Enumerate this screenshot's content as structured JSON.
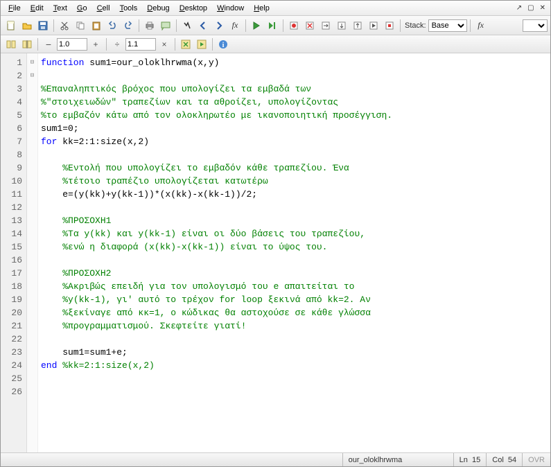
{
  "menu": [
    "File",
    "Edit",
    "Text",
    "Go",
    "Cell",
    "Tools",
    "Debug",
    "Desktop",
    "Window",
    "Help"
  ],
  "toolbar2": {
    "val1": "1.0",
    "val2": "1.1"
  },
  "stack": {
    "label": "Stack:",
    "value": "Base"
  },
  "fx": "fx",
  "status": {
    "func": "our_oloklhrwma",
    "ln_label": "Ln",
    "ln": "15",
    "col_label": "Col",
    "col": "54",
    "ovr": "OVR"
  },
  "lines": [
    {
      "n": 1,
      "fold": "⊟",
      "seg": [
        {
          "c": "kw",
          "t": "function "
        },
        {
          "c": "pl",
          "t": "sum1=our_oloklhrwma(x,y)"
        }
      ]
    },
    {
      "n": 2,
      "seg": []
    },
    {
      "n": 3,
      "seg": [
        {
          "c": "cm",
          "t": "%Επαναληπτικός βρόχος που υπολογίζει τα εμβαδά των"
        }
      ]
    },
    {
      "n": 4,
      "seg": [
        {
          "c": "cm",
          "t": "%\"στοιχειωδών\" τραπεζίων και τα αθροίζει, υπολογίζοντας"
        }
      ]
    },
    {
      "n": 5,
      "seg": [
        {
          "c": "cm",
          "t": "%το εμβαζόν κάτω από τον ολοκληρωτέο με ικανοποιητική προσέγγιση."
        }
      ]
    },
    {
      "n": 6,
      "seg": [
        {
          "c": "pl",
          "t": "sum1=0;"
        }
      ]
    },
    {
      "n": 7,
      "fold": "⊟",
      "seg": [
        {
          "c": "kw",
          "t": "for "
        },
        {
          "c": "pl",
          "t": "kk=2:1:size(x,2)"
        }
      ]
    },
    {
      "n": 8,
      "seg": []
    },
    {
      "n": 9,
      "seg": [
        {
          "c": "pl",
          "t": "    "
        },
        {
          "c": "cm",
          "t": "%Εντολή που υπολογίζει το εμβαδόν κάθε τραπεζίου. Ένα"
        }
      ]
    },
    {
      "n": 10,
      "seg": [
        {
          "c": "pl",
          "t": "    "
        },
        {
          "c": "cm",
          "t": "%τέτοιο τραπέζιο υπολογίζεται κατωτέρω"
        }
      ]
    },
    {
      "n": 11,
      "seg": [
        {
          "c": "pl",
          "t": "    e=(y(kk)+y(kk-1))*(x(kk)-x(kk-1))/2;"
        }
      ]
    },
    {
      "n": 12,
      "seg": []
    },
    {
      "n": 13,
      "seg": [
        {
          "c": "pl",
          "t": "    "
        },
        {
          "c": "cm",
          "t": "%ΠΡΟΣΟΧΗ1"
        }
      ]
    },
    {
      "n": 14,
      "seg": [
        {
          "c": "pl",
          "t": "    "
        },
        {
          "c": "cm",
          "t": "%Τα y(kk) και y(kk-1) είναι οι δύο βάσεις του τραπεζίου,"
        }
      ]
    },
    {
      "n": 15,
      "seg": [
        {
          "c": "pl",
          "t": "    "
        },
        {
          "c": "cm",
          "t": "%ενώ η διαφορά (x(kk)-x(kk-1)) είναι το ύψος του."
        }
      ]
    },
    {
      "n": 16,
      "seg": []
    },
    {
      "n": 17,
      "seg": [
        {
          "c": "pl",
          "t": "    "
        },
        {
          "c": "cm",
          "t": "%ΠΡΟΣΟΧΗ2"
        }
      ]
    },
    {
      "n": 18,
      "seg": [
        {
          "c": "pl",
          "t": "    "
        },
        {
          "c": "cm",
          "t": "%Ακριβώς επειδή για τον υπολογισμό του e απαιτείται το"
        }
      ]
    },
    {
      "n": 19,
      "seg": [
        {
          "c": "pl",
          "t": "    "
        },
        {
          "c": "cm",
          "t": "%y(kk-1), γι' αυτό το τρέχον for loop ξεκινά από kk=2. Αν"
        }
      ]
    },
    {
      "n": 20,
      "seg": [
        {
          "c": "pl",
          "t": "    "
        },
        {
          "c": "cm",
          "t": "%ξεκίναγε από κκ=1, ο κώδικας θα αστοχούσε σε κάθε γλώσσα"
        }
      ]
    },
    {
      "n": 21,
      "seg": [
        {
          "c": "pl",
          "t": "    "
        },
        {
          "c": "cm",
          "t": "%προγραμματισμού. Σκεφτείτε γιατί!"
        }
      ]
    },
    {
      "n": 22,
      "seg": []
    },
    {
      "n": 23,
      "seg": [
        {
          "c": "pl",
          "t": "    sum1=sum1+e;"
        }
      ]
    },
    {
      "n": 24,
      "seg": [
        {
          "c": "kw",
          "t": "end "
        },
        {
          "c": "cm",
          "t": "%kk=2:1:size(x,2)"
        }
      ]
    },
    {
      "n": 25,
      "seg": []
    },
    {
      "n": 26,
      "seg": []
    }
  ]
}
